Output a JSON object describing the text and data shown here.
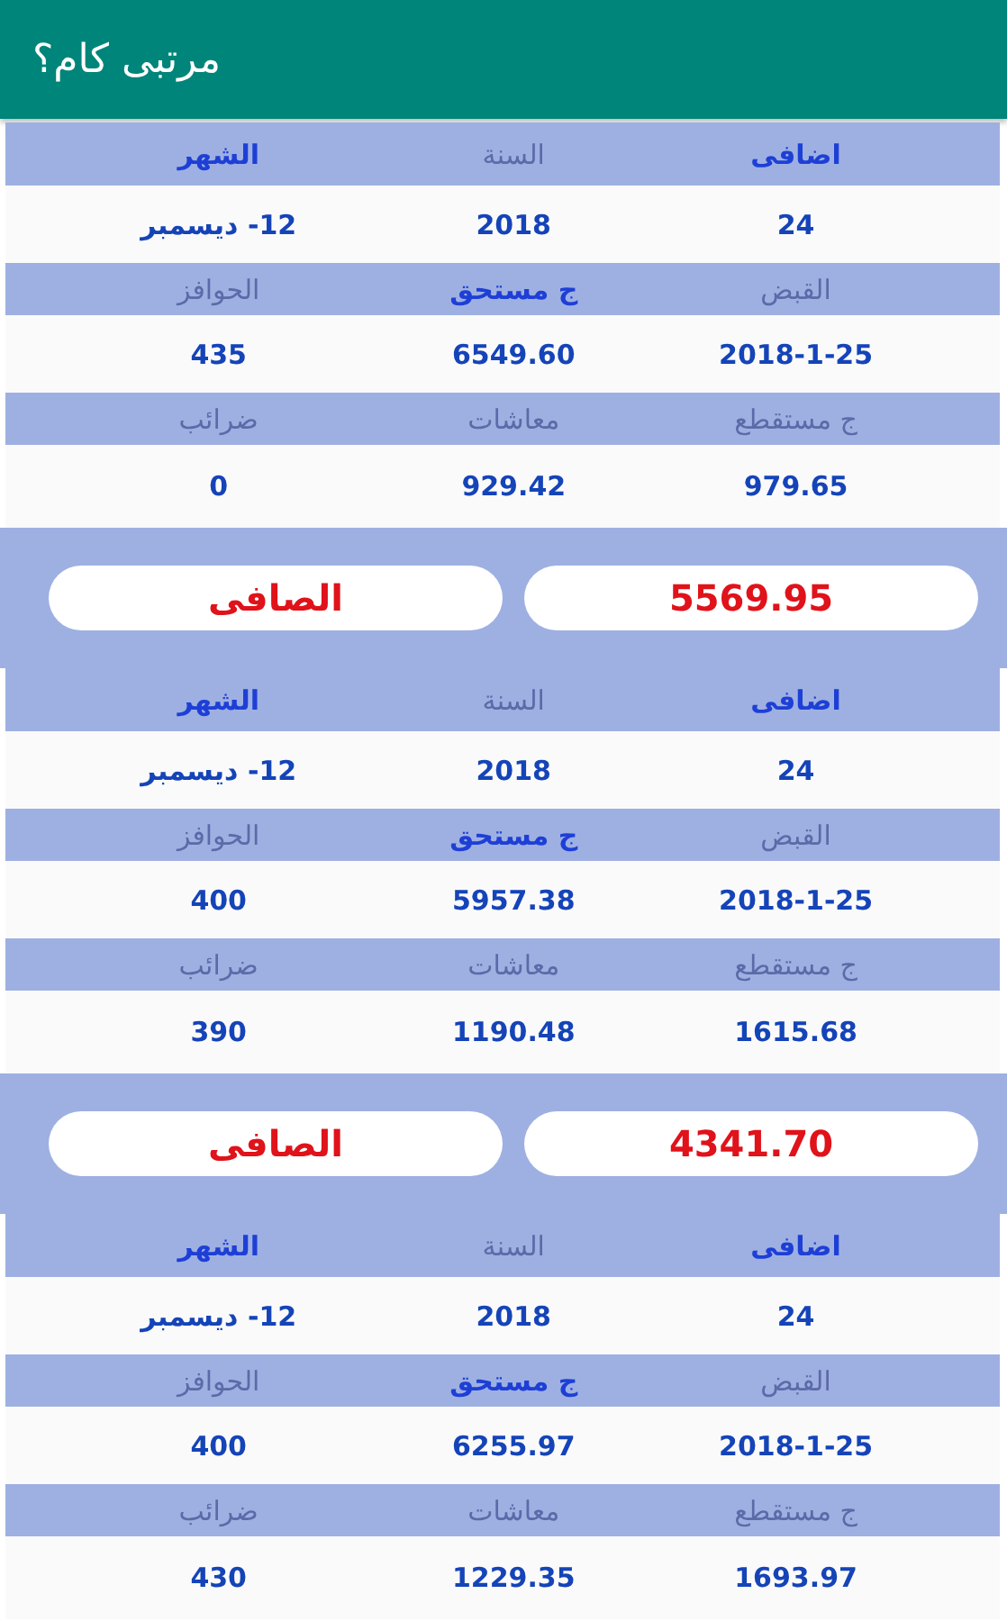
{
  "app_bar": {
    "title": "مرتبى كام؟"
  },
  "records": [
    {
      "rows": [
        {
          "labels": [
            {
              "text": "اضافى",
              "color": "#1e3fd6"
            },
            {
              "text": "السنة",
              "color": "#5b6aa8"
            },
            {
              "text": "الشهر",
              "color": "#1e3fd6"
            }
          ],
          "values": [
            "24",
            "2018",
            "12- ديسمبر"
          ]
        },
        {
          "labels": [
            {
              "text": "القبض",
              "color": "#5b6aa8"
            },
            {
              "text": "ج مستحق",
              "color": "#1e3fd6"
            },
            {
              "text": "الحوافز",
              "color": "#5b6aa8"
            }
          ],
          "values": [
            "2018-1-25",
            "6549.60",
            "435"
          ]
        },
        {
          "labels": [
            {
              "text": "ج مستقطع",
              "color": "#5b6aa8"
            },
            {
              "text": "معاشات",
              "color": "#5b6aa8"
            },
            {
              "text": "ضرائب",
              "color": "#5b6aa8"
            }
          ],
          "values": [
            "979.65",
            "929.42",
            "0"
          ]
        }
      ],
      "net": {
        "value": "5569.95",
        "label": "الصافى"
      }
    },
    {
      "rows": [
        {
          "labels": [
            {
              "text": "اضافى",
              "color": "#1e3fd6"
            },
            {
              "text": "السنة",
              "color": "#5b6aa8"
            },
            {
              "text": "الشهر",
              "color": "#1e3fd6"
            }
          ],
          "values": [
            "24",
            "2018",
            "12- ديسمبر"
          ]
        },
        {
          "labels": [
            {
              "text": "القبض",
              "color": "#5b6aa8"
            },
            {
              "text": "ج مستحق",
              "color": "#1e3fd6"
            },
            {
              "text": "الحوافز",
              "color": "#5b6aa8"
            }
          ],
          "values": [
            "2018-1-25",
            "5957.38",
            "400"
          ]
        },
        {
          "labels": [
            {
              "text": "ج مستقطع",
              "color": "#5b6aa8"
            },
            {
              "text": "معاشات",
              "color": "#5b6aa8"
            },
            {
              "text": "ضرائب",
              "color": "#5b6aa8"
            }
          ],
          "values": [
            "1615.68",
            "1190.48",
            "390"
          ]
        }
      ],
      "net": {
        "value": "4341.70",
        "label": "الصافى"
      }
    },
    {
      "rows": [
        {
          "labels": [
            {
              "text": "اضافى",
              "color": "#1e3fd6"
            },
            {
              "text": "السنة",
              "color": "#5b6aa8"
            },
            {
              "text": "الشهر",
              "color": "#1e3fd6"
            }
          ],
          "values": [
            "24",
            "2018",
            "12- ديسمبر"
          ]
        },
        {
          "labels": [
            {
              "text": "القبض",
              "color": "#5b6aa8"
            },
            {
              "text": "ج مستحق",
              "color": "#1e3fd6"
            },
            {
              "text": "الحوافز",
              "color": "#5b6aa8"
            }
          ],
          "values": [
            "2018-1-25",
            "6255.97",
            "400"
          ]
        },
        {
          "labels": [
            {
              "text": "ج مستقطع",
              "color": "#5b6aa8"
            },
            {
              "text": "معاشات",
              "color": "#5b6aa8"
            },
            {
              "text": "ضرائب",
              "color": "#5b6aa8"
            }
          ],
          "values": [
            "1693.97",
            "1229.35",
            "430"
          ]
        }
      ]
    }
  ]
}
